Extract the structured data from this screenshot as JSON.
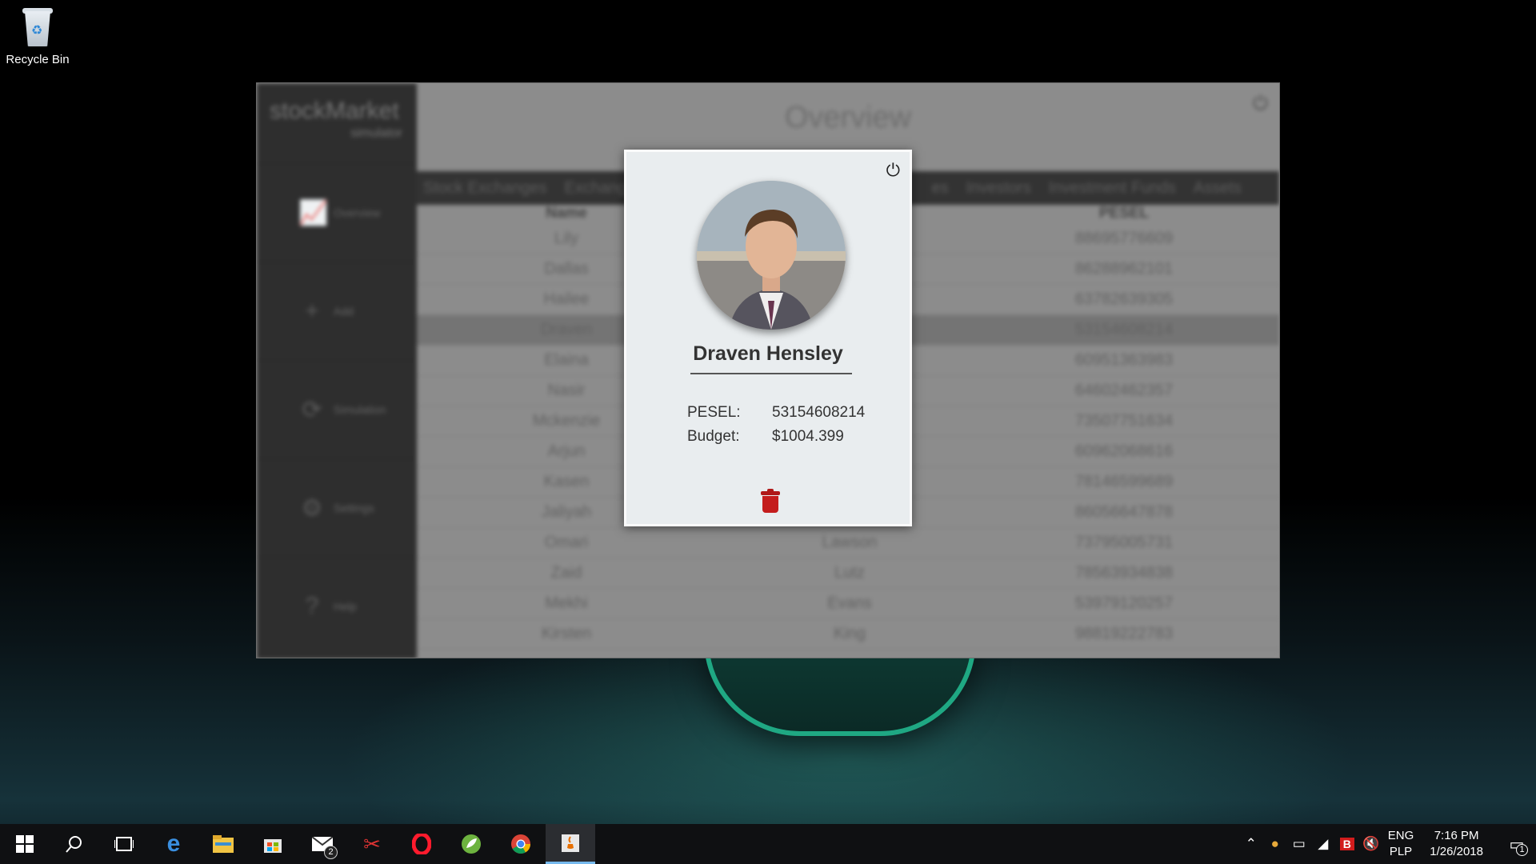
{
  "desktop": {
    "recycle_bin_label": "Recycle Bin"
  },
  "app": {
    "brand_title": "stockMarket",
    "brand_sub": "simulator",
    "page_title": "Overview",
    "sidebar": [
      {
        "icon": "chart-icon",
        "label": "Overview"
      },
      {
        "icon": "plus-icon",
        "label": "Add"
      },
      {
        "icon": "refresh-icon",
        "label": "Simulation"
      },
      {
        "icon": "gear-icon",
        "label": "Settings"
      },
      {
        "icon": "help-icon",
        "label": "Help"
      }
    ],
    "tabs": [
      "Stock Exchanges",
      "Exchange",
      "es",
      "Investors",
      "Investment Funds",
      "Assets"
    ],
    "table": {
      "headers": [
        "Name",
        "",
        "PESEL"
      ],
      "rows": [
        [
          "Lily",
          "",
          "88695776609"
        ],
        [
          "Dallas",
          "",
          "86288962101"
        ],
        [
          "Hailee",
          "",
          "63782639305"
        ],
        [
          "Draven",
          "",
          "53154608214"
        ],
        [
          "Elaina",
          "",
          "60951363983"
        ],
        [
          "Nasir",
          "",
          "64602462357"
        ],
        [
          "Mckenzie",
          "",
          "73507751634"
        ],
        [
          "Arjun",
          "",
          "60962068616"
        ],
        [
          "Kasen",
          "",
          "78146599689"
        ],
        [
          "Jaliyah",
          "",
          "86056647878"
        ],
        [
          "Omari",
          "Lawson",
          "73795005731"
        ],
        [
          "Zaid",
          "Lutz",
          "78563934838"
        ],
        [
          "Mekhi",
          "Evans",
          "53979120257"
        ],
        [
          "Kirsten",
          "King",
          "98819222783"
        ]
      ],
      "selected_row": 3
    }
  },
  "modal": {
    "name": "Draven Hensley",
    "pesel_label": "PESEL:",
    "pesel_value": "53154608214",
    "budget_label": "Budget:",
    "budget_value": "$1004.399"
  },
  "taskbar": {
    "mail_badge": "2",
    "lang_top": "ENG",
    "lang_bottom": "PLP",
    "time": "7:16 PM",
    "date": "1/26/2018",
    "notif_count": "1"
  },
  "colors": {
    "accent": "#76b9ed",
    "delete": "#c41d1d"
  }
}
